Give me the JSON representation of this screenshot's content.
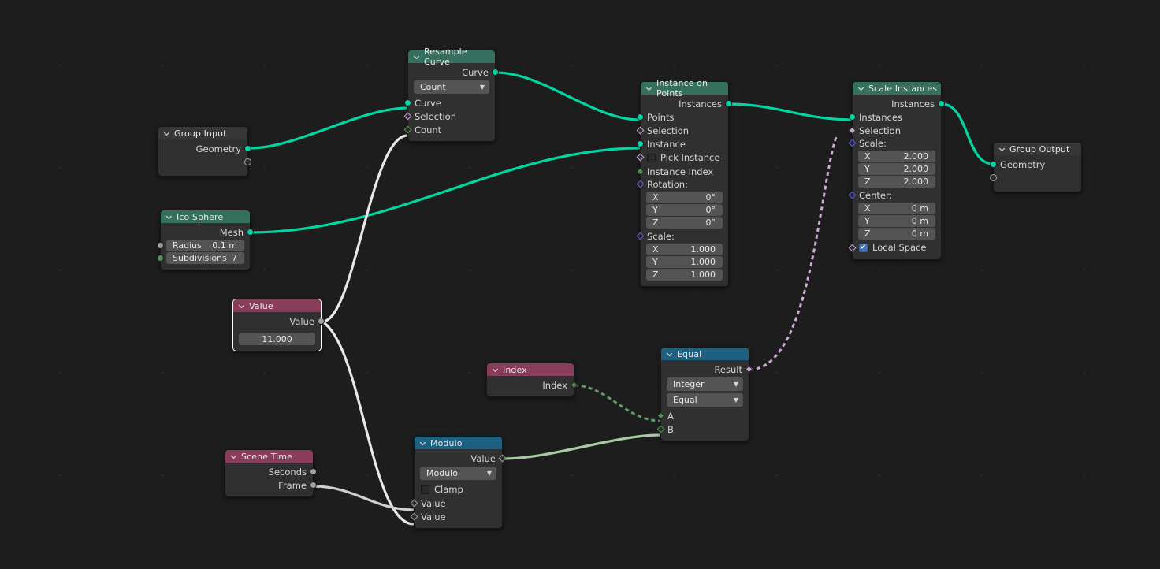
{
  "editor": {
    "name": "Geometry Node Editor",
    "background_color": "#1d1d1d"
  },
  "colors": {
    "header_geometry": "#356f5e",
    "header_converter": "#1d6080",
    "header_input": "#893d5b",
    "header_group": "#373737",
    "socket_geometry": "#00d6a3",
    "socket_float": "#a1a1a1",
    "socket_integer": "#598c5c",
    "socket_boolean": "#cca6d6",
    "socket_vector": "#6363c7",
    "link_geometry": "#00d6a3",
    "link_selected": "#f0f0f0",
    "link_boolean_field": "#cca6d6",
    "link_integer_field": "#5a9160"
  },
  "nodes": {
    "group_input": {
      "title": "Group Input",
      "outputs": [
        {
          "label": "Geometry",
          "type": "geometry"
        },
        {
          "label": "",
          "type": "virtual"
        }
      ]
    },
    "ico_sphere": {
      "title": "Ico Sphere",
      "outputs": [
        {
          "label": "Mesh",
          "type": "geometry"
        }
      ],
      "fields": [
        {
          "label": "Radius",
          "value": "0.1 m",
          "type": "float"
        },
        {
          "label": "Subdivisions",
          "value": "7",
          "type": "integer"
        }
      ]
    },
    "resample_curve": {
      "title": "Resample Curve",
      "outputs": [
        {
          "label": "Curve",
          "type": "geometry"
        }
      ],
      "mode": "Count",
      "inputs": [
        {
          "label": "Curve",
          "type": "geometry"
        },
        {
          "label": "Selection",
          "type": "boolean"
        },
        {
          "label": "Count",
          "type": "integer"
        }
      ]
    },
    "instance_on_points": {
      "title": "Instance on Points",
      "outputs": [
        {
          "label": "Instances",
          "type": "geometry"
        }
      ],
      "inputs": [
        {
          "label": "Points",
          "type": "geometry"
        },
        {
          "label": "Selection",
          "type": "boolean"
        },
        {
          "label": "Instance",
          "type": "geometry"
        },
        {
          "label": "Pick Instance",
          "type": "boolean"
        },
        {
          "label": "Instance Index",
          "type": "integer"
        }
      ],
      "rotation_label": "Rotation:",
      "rotation": [
        {
          "axis": "X",
          "value": "0°"
        },
        {
          "axis": "Y",
          "value": "0°"
        },
        {
          "axis": "Z",
          "value": "0°"
        }
      ],
      "scale_label": "Scale:",
      "scale": [
        {
          "axis": "X",
          "value": "1.000"
        },
        {
          "axis": "Y",
          "value": "1.000"
        },
        {
          "axis": "Z",
          "value": "1.000"
        }
      ],
      "pick_instance_checked": false
    },
    "scale_instances": {
      "title": "Scale Instances",
      "outputs": [
        {
          "label": "Instances",
          "type": "geometry"
        }
      ],
      "inputs": [
        {
          "label": "Instances",
          "type": "geometry"
        },
        {
          "label": "Selection",
          "type": "boolean"
        }
      ],
      "scale_label": "Scale:",
      "scale": [
        {
          "axis": "X",
          "value": "2.000"
        },
        {
          "axis": "Y",
          "value": "2.000"
        },
        {
          "axis": "Z",
          "value": "2.000"
        }
      ],
      "center_label": "Center:",
      "center": [
        {
          "axis": "X",
          "value": "0 m"
        },
        {
          "axis": "Y",
          "value": "0 m"
        },
        {
          "axis": "Z",
          "value": "0 m"
        }
      ],
      "local_space_label": "Local Space",
      "local_space_checked": true
    },
    "group_output": {
      "title": "Group Output",
      "inputs": [
        {
          "label": "Geometry",
          "type": "geometry"
        },
        {
          "label": "",
          "type": "virtual"
        }
      ]
    },
    "value": {
      "title": "Value",
      "selected": true,
      "outputs": [
        {
          "label": "Value",
          "type": "float"
        }
      ],
      "value": "11.000"
    },
    "index": {
      "title": "Index",
      "outputs": [
        {
          "label": "Index",
          "type": "integer"
        }
      ]
    },
    "scene_time": {
      "title": "Scene Time",
      "outputs": [
        {
          "label": "Seconds",
          "type": "float"
        },
        {
          "label": "Frame",
          "type": "float"
        }
      ]
    },
    "modulo": {
      "title": "Modulo",
      "outputs": [
        {
          "label": "Value",
          "type": "float"
        }
      ],
      "operation": "Modulo",
      "clamp_label": "Clamp",
      "clamp_checked": false,
      "inputs": [
        {
          "label": "Value",
          "type": "float"
        },
        {
          "label": "Value",
          "type": "float"
        }
      ]
    },
    "equal": {
      "title": "Equal",
      "outputs": [
        {
          "label": "Result",
          "type": "boolean"
        }
      ],
      "data_type": "Integer",
      "operation": "Equal",
      "inputs": [
        {
          "label": "A",
          "type": "integer"
        },
        {
          "label": "B",
          "type": "integer"
        }
      ]
    }
  }
}
